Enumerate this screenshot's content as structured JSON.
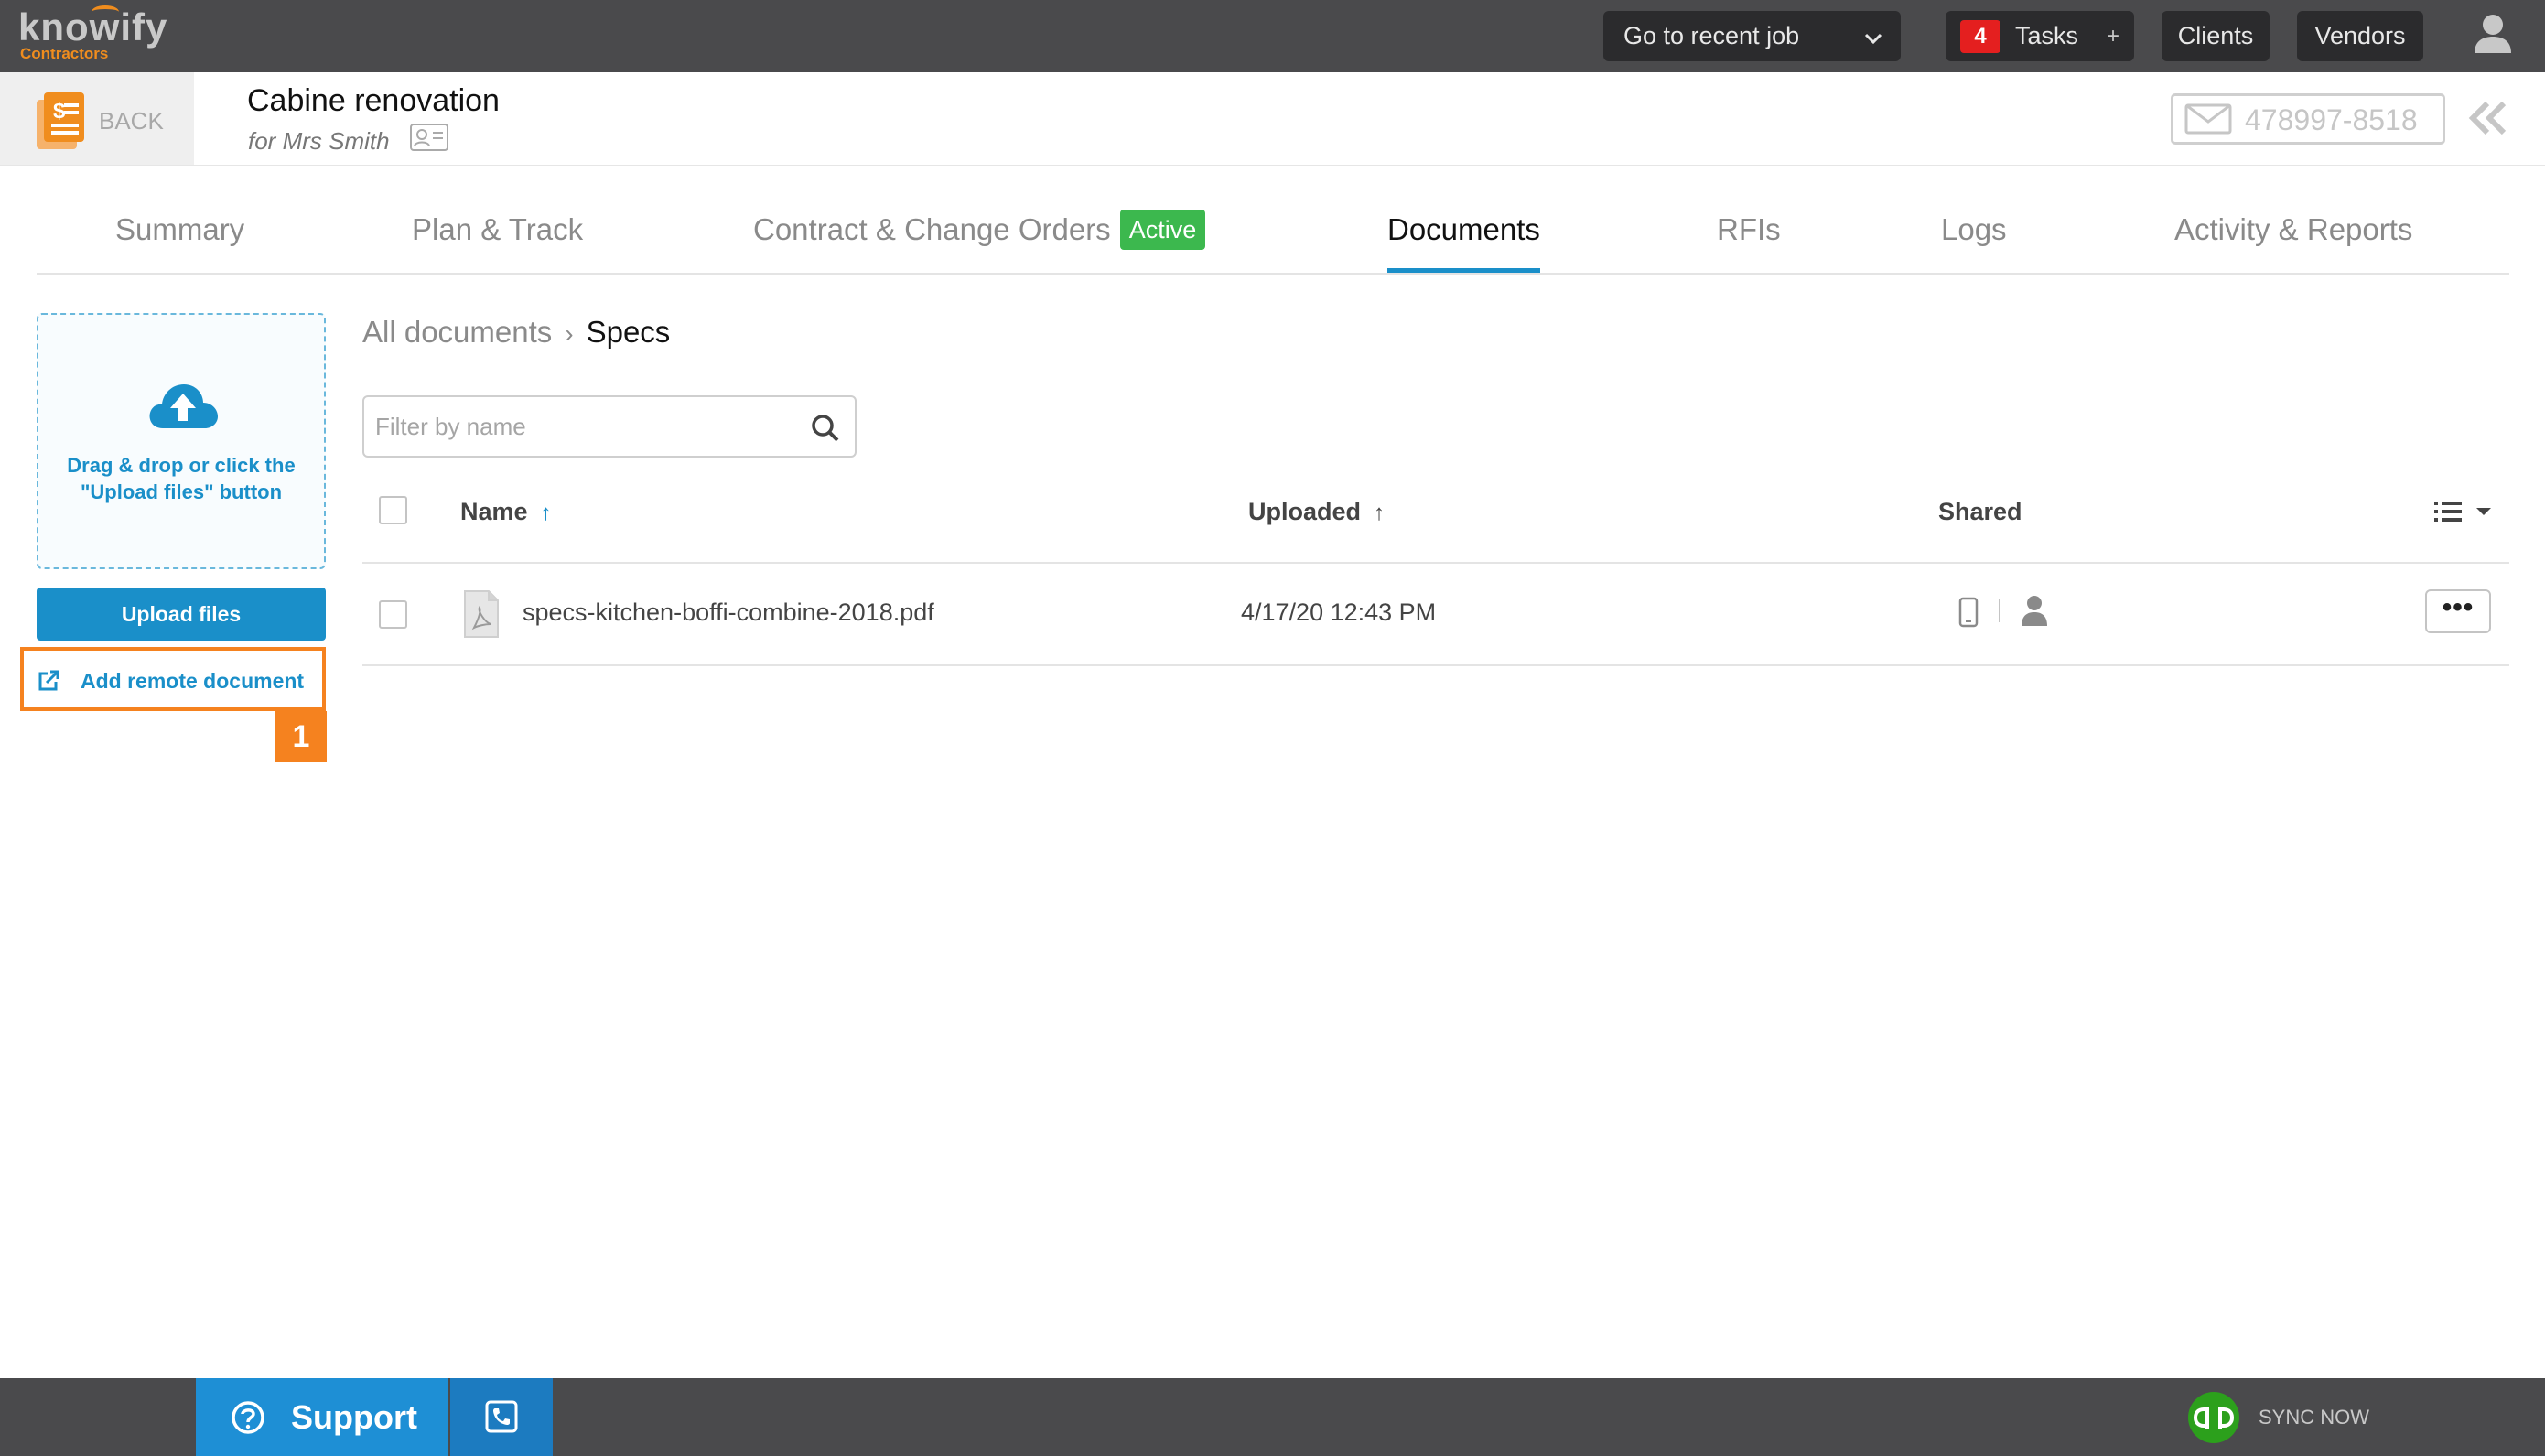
{
  "topbar": {
    "logo_main": "knowify",
    "logo_sub": "Contractors",
    "recent_job_label": "Go to recent job",
    "tasks_count": "4",
    "tasks_label": "Tasks",
    "tasks_plus": "+",
    "clients_label": "Clients",
    "vendors_label": "Vendors"
  },
  "header": {
    "back_label": "BACK",
    "job_title": "Cabine renovation",
    "job_client": "for Mrs Smith",
    "phone_number": "478997-8518"
  },
  "tabs": [
    {
      "label": "Summary"
    },
    {
      "label": "Plan & Track"
    },
    {
      "label": "Contract & Change Orders",
      "badge": "Active"
    },
    {
      "label": "Documents",
      "active": true
    },
    {
      "label": "RFIs"
    },
    {
      "label": "Logs"
    },
    {
      "label": "Activity & Reports"
    }
  ],
  "sidebar": {
    "dropzone_text_line1": "Drag & drop or click the",
    "dropzone_text_line2": "\"Upload files\" button",
    "upload_button": "Upload files",
    "remote_document": "Add remote document",
    "step_badge": "1"
  },
  "breadcrumb": {
    "root": "All documents",
    "separator": "›",
    "current": "Specs"
  },
  "filter": {
    "placeholder": "Filter by name",
    "value": ""
  },
  "table": {
    "columns": {
      "name": "Name",
      "uploaded": "Uploaded",
      "shared": "Shared"
    },
    "sort_arrow": "↑",
    "rows": [
      {
        "name": "specs-kitchen-boffi-combine-2018.pdf",
        "uploaded": "4/17/20 12:43 PM",
        "more": "•••"
      }
    ]
  },
  "bottombar": {
    "support_label": "Support",
    "sync_label": "SYNC NOW"
  },
  "colors": {
    "accent_blue": "#1a8fc9",
    "orange": "#f5821f",
    "active_green": "#3cb84e",
    "badge_red": "#e41f1f",
    "bar_dark": "#4a4a4c"
  }
}
